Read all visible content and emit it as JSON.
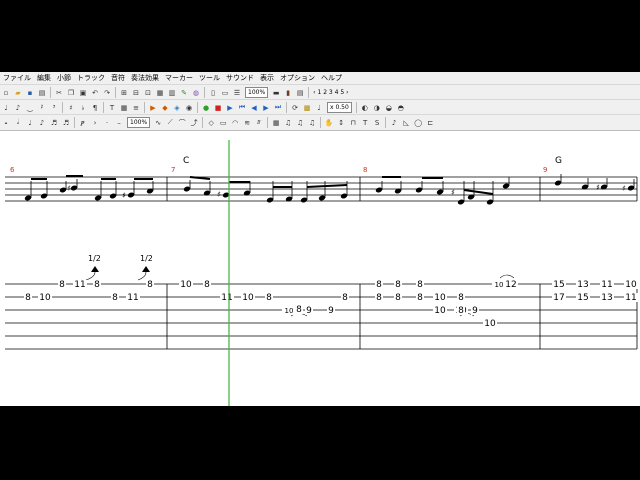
{
  "menu": [
    "ファイル",
    "編集",
    "小節",
    "トラック",
    "音符",
    "奏法効果",
    "マーカー",
    "ツール",
    "サウンド",
    "表示",
    "オプション",
    "ヘルプ"
  ],
  "toolbar": {
    "zoom": "100%",
    "pages": "‹ 1 2 3 4 5 ›",
    "speed": "x 0.50",
    "percent": "100%"
  },
  "score": {
    "chords": [
      "C",
      "G"
    ],
    "measure_numbers": [
      "6",
      "7",
      "8",
      "9"
    ],
    "bends": [
      "1/2",
      "1/2"
    ],
    "tab_numbers": [
      {
        "string": 2,
        "fret": "8"
      },
      {
        "string": 2,
        "fret": "10"
      },
      {
        "string": 1,
        "fret": "8"
      },
      {
        "string": 1,
        "fret": "11"
      },
      {
        "string": 1,
        "fret": "8"
      },
      {
        "string": 2,
        "fret": "8"
      },
      {
        "string": 2,
        "fret": "11"
      },
      {
        "string": 1,
        "fret": "8"
      },
      {
        "string": 1,
        "fret": "10"
      },
      {
        "string": 1,
        "fret": "8"
      },
      {
        "string": 2,
        "fret": "11"
      },
      {
        "string": 2,
        "fret": "10"
      },
      {
        "string": 2,
        "fret": "8"
      },
      {
        "string": 3,
        "fret": "10"
      },
      {
        "string": 3,
        "fret": "8"
      },
      {
        "string": 3,
        "fret": "9"
      },
      {
        "string": 3,
        "fret": "9"
      },
      {
        "string": 2,
        "fret": "8"
      },
      {
        "string": 1,
        "fret": "8"
      },
      {
        "string": 2,
        "fret": "8"
      },
      {
        "string": 1,
        "fret": "8"
      },
      {
        "string": 2,
        "fret": "8"
      },
      {
        "string": 1,
        "fret": "8"
      },
      {
        "string": 2,
        "fret": "8"
      },
      {
        "string": 3,
        "fret": "10"
      },
      {
        "string": 2,
        "fret": "10"
      },
      {
        "string": 3,
        "fret": "10"
      },
      {
        "string": 2,
        "fret": "8"
      },
      {
        "string": 3,
        "fret": "8"
      },
      {
        "string": 3,
        "fret": "9"
      },
      {
        "string": 4,
        "fret": "10"
      },
      {
        "string": 1,
        "fret": "10"
      },
      {
        "string": 1,
        "fret": "12"
      },
      {
        "string": 1,
        "fret": "15"
      },
      {
        "string": 2,
        "fret": "17"
      },
      {
        "string": 1,
        "fret": "13"
      },
      {
        "string": 2,
        "fret": "15"
      },
      {
        "string": 1,
        "fret": "11"
      },
      {
        "string": 2,
        "fret": "13"
      },
      {
        "string": 1,
        "fret": "10"
      },
      {
        "string": 2,
        "fret": "11"
      }
    ]
  },
  "colors": {
    "playhead": "#3cb43c",
    "measure_number": "#c0392b"
  }
}
